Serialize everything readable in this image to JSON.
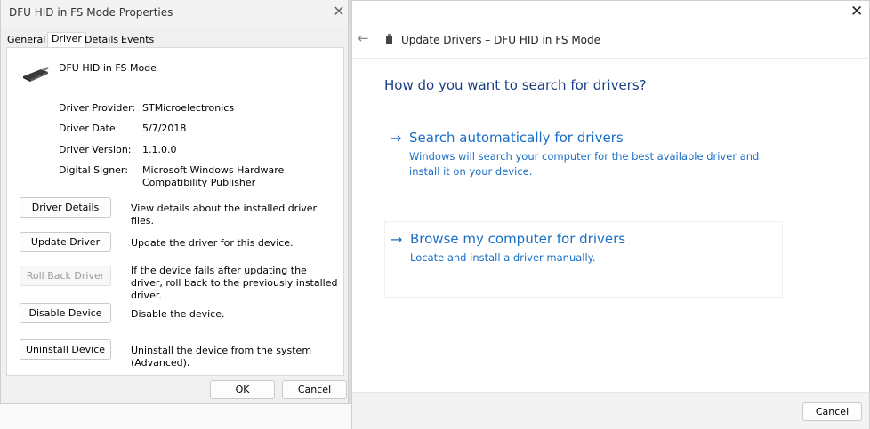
{
  "properties": {
    "title": "DFU HID in FS Mode Properties",
    "tabs": [
      "General",
      "Driver",
      "Details",
      "Events"
    ],
    "active_tab": "Driver",
    "device_name": "DFU HID in FS Mode",
    "info": {
      "provider_label": "Driver Provider:",
      "provider": "STMicroelectronics",
      "date_label": "Driver Date:",
      "date": "5/7/2018",
      "version_label": "Driver Version:",
      "version": "1.1.0.0",
      "signer_label": "Digital Signer:",
      "signer": "Microsoft Windows Hardware Compatibility Publisher"
    },
    "actions": {
      "details_label": "Driver Details",
      "details_desc": "View details about the installed driver files.",
      "update_label": "Update Driver",
      "update_desc": "Update the driver for this device.",
      "rollback_label": "Roll Back Driver",
      "rollback_desc": "If the device fails after updating the driver, roll back to the previously installed driver.",
      "disable_label": "Disable Device",
      "disable_desc": "Disable the device.",
      "uninstall_label": "Uninstall Device",
      "uninstall_desc": "Uninstall the device from the system (Advanced)."
    },
    "ok_label": "OK",
    "cancel_label": "Cancel"
  },
  "wizard": {
    "title": "Update Drivers – DFU HID in FS Mode",
    "question": "How do you want to search for drivers?",
    "option_auto": {
      "title": "Search automatically for drivers",
      "desc": "Windows will search your computer for the best available driver and install it on your device."
    },
    "option_browse": {
      "title": "Browse my computer for drivers",
      "desc": "Locate and install a driver manually."
    },
    "cancel_label": "Cancel"
  },
  "icons": {
    "close": "close-icon",
    "back": "back-arrow-icon",
    "device": "usb-device-icon",
    "arrow": "arrow-right-icon"
  },
  "colors": {
    "link_blue": "#1a6ec4",
    "heading_blue": "#1b3e83"
  }
}
